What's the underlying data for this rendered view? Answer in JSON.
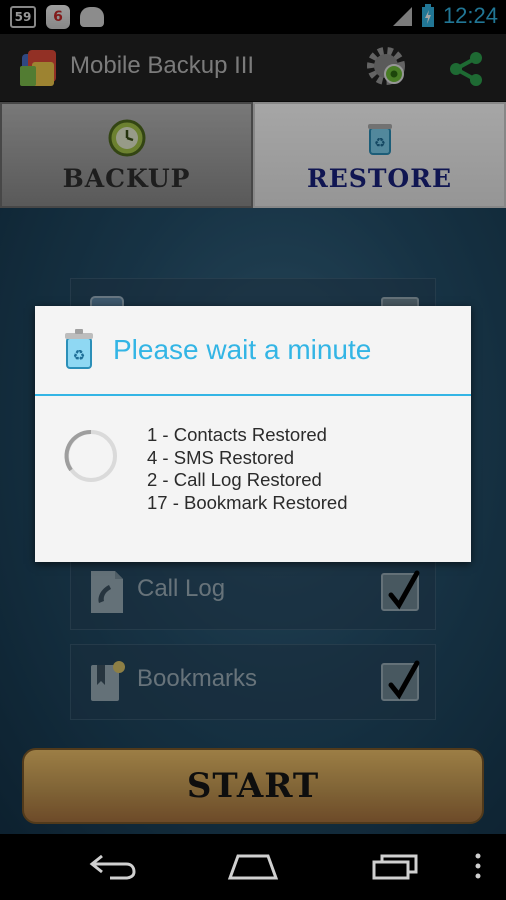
{
  "status_bar": {
    "notification_badge": "59",
    "app_badge": "6",
    "time": "12:24"
  },
  "action_bar": {
    "title": "Mobile Backup III"
  },
  "tabs": [
    {
      "label": "BACKUP"
    },
    {
      "label": "RESTORE"
    }
  ],
  "list_items": [
    {
      "label": "Call Log",
      "checked": true
    },
    {
      "label": "Bookmarks",
      "checked": true
    }
  ],
  "start_button": {
    "label": "START"
  },
  "dialog": {
    "title": "Please wait a minute",
    "messages": [
      "1 - Contacts Restored",
      "4 - SMS Restored",
      "2 - Call Log Restored",
      "17 - Bookmark Restored"
    ]
  },
  "colors": {
    "accent": "#33b5e5",
    "restore_tab_text": "#1a237e",
    "start_button": "#d9a95c"
  }
}
